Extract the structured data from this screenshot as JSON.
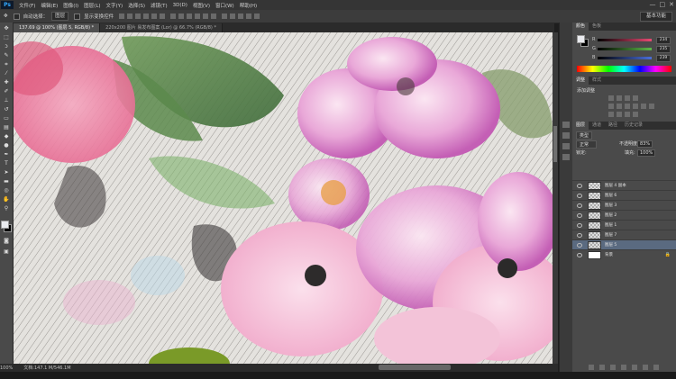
{
  "app": {
    "logo": "Ps"
  },
  "menu": [
    "文件(F)",
    "编辑(E)",
    "图像(I)",
    "图层(L)",
    "文字(Y)",
    "选择(S)",
    "滤镜(T)",
    "3D(D)",
    "视图(V)",
    "窗口(W)",
    "帮助(H)"
  ],
  "window_controls": [
    "—",
    "□",
    "✕"
  ],
  "options": {
    "auto_select": "自动选择：",
    "auto_select_target": "图层",
    "show_transform": "显示变换控件",
    "workspace": "基本功能"
  },
  "tabs": [
    {
      "label": "137.69 @ 100% (图层 5, RGB/8) *",
      "active": true
    },
    {
      "label": "220x200 图片 易发布图案 (Lor) @ 66.7% (RGB/8) *",
      "active": false
    }
  ],
  "status": {
    "zoom": "100%",
    "doc": "文档:147.1 M/546.1M"
  },
  "color_panel": {
    "tabs": [
      "颜色",
      "色板"
    ],
    "sliders": [
      {
        "label": "R",
        "value": "234",
        "color": "#ea4a73"
      },
      {
        "label": "G",
        "value": "235",
        "color": "#5dbb4a"
      },
      {
        "label": "B",
        "value": "239",
        "color": "#4a6ed9"
      }
    ]
  },
  "adjust_panel": {
    "tabs": [
      "调整",
      "样式"
    ],
    "title": "添加调整"
  },
  "layers_panel": {
    "tabs": [
      "图层",
      "通道",
      "路径",
      "历史记录"
    ],
    "kind": "类型",
    "blend_mode": "正常",
    "opacity_label": "不透明度:",
    "opacity_value": "83%",
    "lock_label": "锁定:",
    "fill_label": "填充:",
    "fill_value": "100%",
    "layers": [
      {
        "name": "图层 4 副本",
        "selected": false,
        "bg": false
      },
      {
        "name": "图层 6",
        "selected": false,
        "bg": false
      },
      {
        "name": "图层 3",
        "selected": false,
        "bg": false
      },
      {
        "name": "图层 2",
        "selected": false,
        "bg": false
      },
      {
        "name": "图层 1",
        "selected": false,
        "bg": false
      },
      {
        "name": "图层 7",
        "selected": false,
        "bg": false
      },
      {
        "name": "图层 5",
        "selected": true,
        "bg": false
      },
      {
        "name": "背景",
        "selected": false,
        "bg": true
      }
    ]
  },
  "colors": {
    "accent": "#31a8ff",
    "panel": "#4a4a4a",
    "selected_layer": "#5a6a80"
  }
}
